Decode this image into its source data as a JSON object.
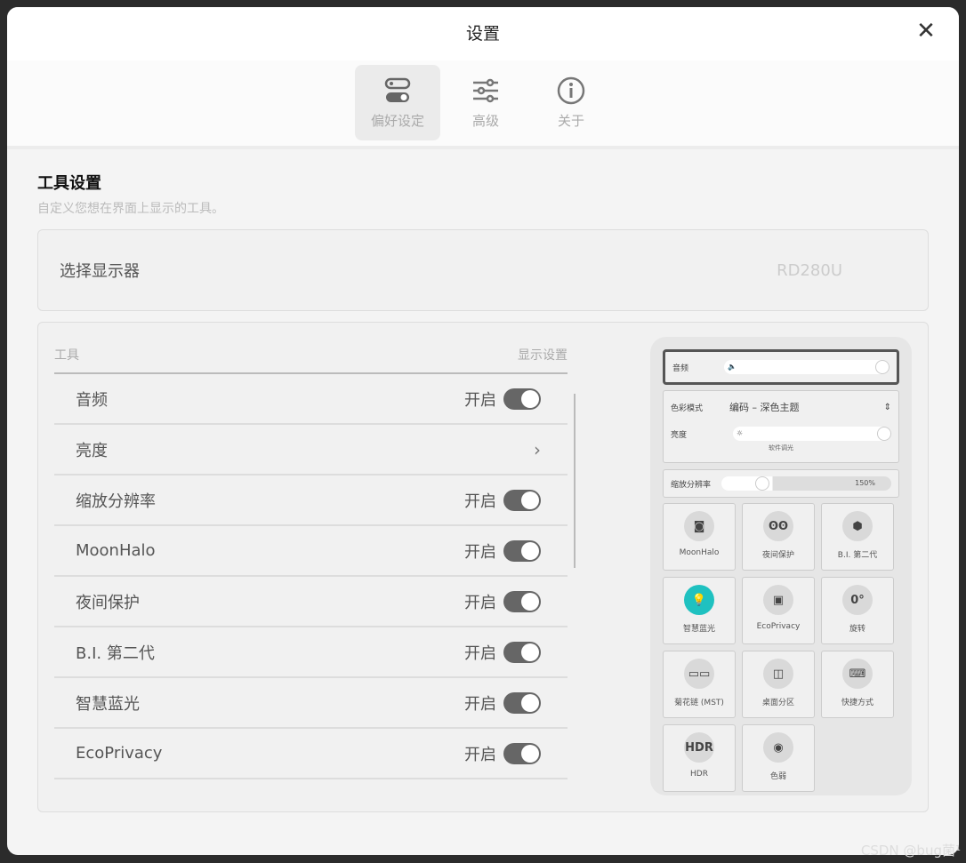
{
  "window": {
    "title": "设置",
    "close_icon": "close-icon"
  },
  "tabs": [
    {
      "label": "偏好设定",
      "icon": "toggles-icon",
      "active": true
    },
    {
      "label": "高级",
      "icon": "sliders-icon"
    },
    {
      "label": "关于",
      "icon": "info-icon"
    }
  ],
  "section": {
    "title": "工具设置",
    "subtitle": "自定义您想在界面上显示的工具。"
  },
  "monitor": {
    "label": "选择显示器",
    "value": "RD280U"
  },
  "tool_list": {
    "col_tool": "工具",
    "col_display": "显示设置",
    "rows": [
      {
        "name": "音频",
        "state": "开启",
        "control": "toggle",
        "on": true
      },
      {
        "name": "亮度",
        "control": "chevron"
      },
      {
        "name": "缩放分辨率",
        "state": "开启",
        "control": "toggle",
        "on": true
      },
      {
        "name": "MoonHalo",
        "state": "开启",
        "control": "toggle",
        "on": true
      },
      {
        "name": "夜间保护",
        "state": "开启",
        "control": "toggle",
        "on": true
      },
      {
        "name": "B.I. 第二代",
        "state": "开启",
        "control": "toggle",
        "on": true
      },
      {
        "name": "智慧蓝光",
        "state": "开启",
        "control": "toggle",
        "on": true
      },
      {
        "name": "EcoPrivacy",
        "state": "开启",
        "control": "toggle",
        "on": true
      }
    ]
  },
  "preview": {
    "audio_label": "音频",
    "audio_icon": "speaker-icon",
    "color_mode_label": "色彩模式",
    "color_mode_value": "编码 – 深色主题",
    "brightness_label": "亮度",
    "brightness_icon": "sun-icon",
    "brightness_caption": "软件调光",
    "scale_label": "缩放分辨率",
    "scale_value": "150%",
    "tiles": [
      {
        "label": "MoonHalo",
        "icon": "moonhalo-icon",
        "glyph": "◙"
      },
      {
        "label": "夜间保护",
        "icon": "owl-icon",
        "glyph": "ʘʘ"
      },
      {
        "label": "B.I. 第二代",
        "icon": "bi-gen2-icon",
        "glyph": "⬢"
      },
      {
        "label": "智慧蓝光",
        "icon": "bulb-icon",
        "glyph": "💡",
        "accent": "#1fc1c0"
      },
      {
        "label": "EcoPrivacy",
        "icon": "eco-privacy-icon",
        "glyph": "▣"
      },
      {
        "label": "旋转",
        "icon": "rotate-icon",
        "glyph": "0°"
      },
      {
        "label": "菊花链 (MST)",
        "icon": "daisy-chain-icon",
        "glyph": "▭▭"
      },
      {
        "label": "桌面分区",
        "icon": "desktop-partition-icon",
        "glyph": "◫"
      },
      {
        "label": "快捷方式",
        "icon": "keyboard-shortcut-icon",
        "glyph": "⌨"
      },
      {
        "label": "HDR",
        "icon": "hdr-icon",
        "glyph": "HDR"
      },
      {
        "label": "色弱",
        "icon": "eye-icon",
        "glyph": "◉"
      }
    ]
  },
  "watermark": "CSDN @bug菌¹"
}
